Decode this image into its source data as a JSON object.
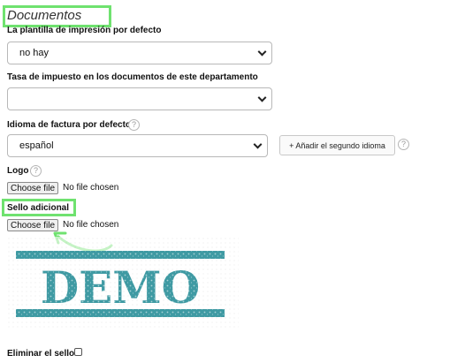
{
  "section": {
    "title": "Documentos"
  },
  "print_template": {
    "label": "La plantilla de impresión por defecto",
    "value": "no hay"
  },
  "tax_rate": {
    "label": "Tasa de impuesto en los documentos de este departamento",
    "value": ""
  },
  "invoice_language": {
    "label": "Idioma de factura por defecto",
    "value": "español",
    "add_button": "+ Añadir el segundo idioma"
  },
  "logo": {
    "label": "Logo",
    "button": "Choose file",
    "status": "No file chosen"
  },
  "stamp": {
    "label": "Sello adicional",
    "button": "Choose file",
    "status": "No file chosen",
    "image_text": "DEMO"
  },
  "remove_stamp": {
    "label": "Eliminar el sello"
  },
  "help_glyph": "?",
  "colors": {
    "highlight": "#6fe26f",
    "stamp": "#3f9aa3",
    "arrow": "#6fe26f"
  }
}
